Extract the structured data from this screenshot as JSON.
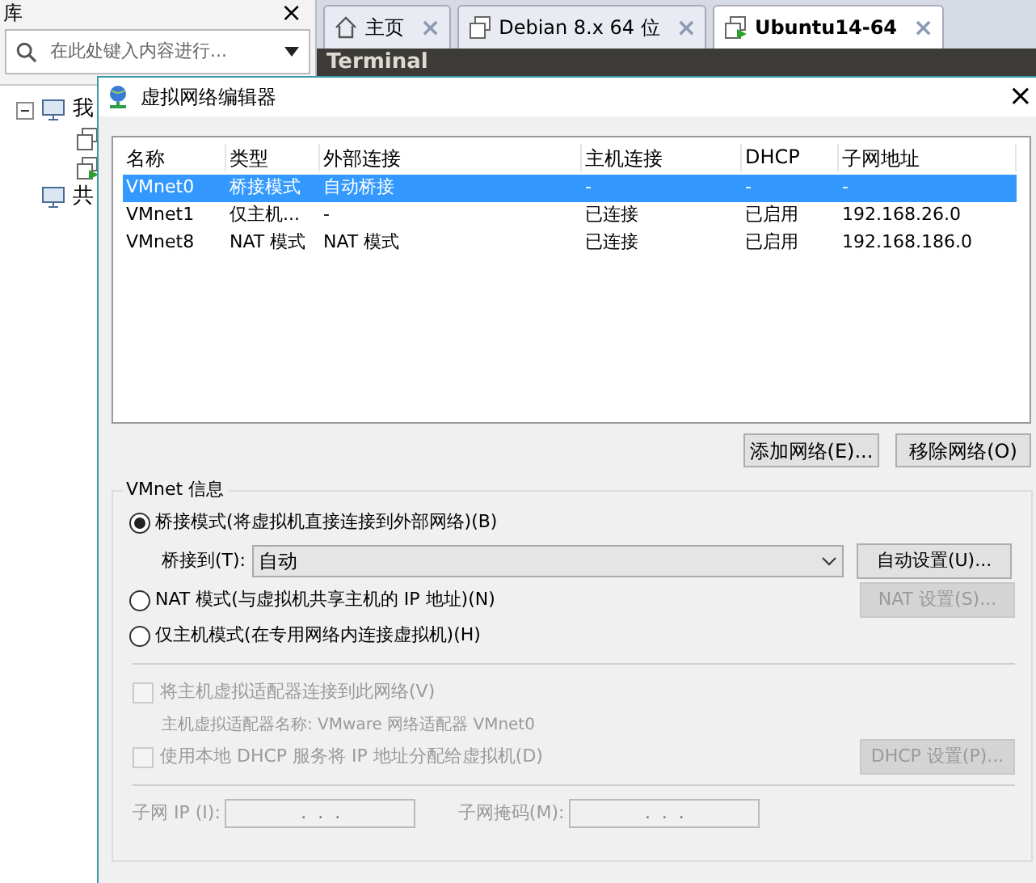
{
  "library": {
    "title": "库",
    "close": "×",
    "search": {
      "placeholder": "在此处键入内容进行..."
    },
    "tree": [
      {
        "label": "我",
        "expanded": true,
        "children": [
          {
            "kind": "vm"
          },
          {
            "kind": "vm-running"
          }
        ]
      },
      {
        "label": "共"
      }
    ]
  },
  "tabs": [
    {
      "label": "主页",
      "kind": "home",
      "selected": false,
      "close": "×"
    },
    {
      "label": "Debian 8.x 64 位",
      "kind": "vm",
      "selected": false,
      "close": "×"
    },
    {
      "label": "Ubuntu14-64",
      "kind": "vm-running",
      "selected": true,
      "close": "×"
    }
  ],
  "vm_title": "Terminal",
  "dialog": {
    "title": "虚拟网络编辑器",
    "close": "×",
    "table": {
      "columns": [
        "名称",
        "类型",
        "外部连接",
        "主机连接",
        "DHCP",
        "子网地址"
      ],
      "rows": [
        {
          "cells": [
            "VMnet0",
            "桥接模式",
            "自动桥接",
            "-",
            "-",
            "-"
          ],
          "selected": true
        },
        {
          "cells": [
            "VMnet1",
            "仅主机...",
            "-",
            "已连接",
            "已启用",
            "192.168.26.0"
          ],
          "selected": false
        },
        {
          "cells": [
            "VMnet8",
            "NAT 模式",
            "NAT 模式",
            "已连接",
            "已启用",
            "192.168.186.0"
          ],
          "selected": false
        }
      ]
    },
    "buttons": [
      "添加网络(E)...",
      "移除网络(O)"
    ],
    "info": {
      "title": "VMnet 信息",
      "modes": [
        {
          "label": "桥接模式(将虚拟机直接连接到外部网络)(B)",
          "selected": true
        },
        {
          "label": "NAT 模式(与虚拟机共享主机的 IP 地址)(N)",
          "selected": false
        },
        {
          "label": "仅主机模式(在专用网络内连接虚拟机)(H)",
          "selected": false
        }
      ],
      "bridge_label": "桥接到(T):",
      "bridge_value": "自动",
      "auto_button": {
        "label": "自动设置(U)...",
        "disabled": false
      },
      "nat_button": {
        "label": "NAT 设置(S)...",
        "disabled": true
      },
      "host_adapter": {
        "label": "将主机虚拟适配器连接到此网络(V)",
        "checked": false,
        "disabled": true
      },
      "adapter_name": "主机虚拟适配器名称: VMware 网络适配器 VMnet0",
      "dhcp": {
        "label": "使用本地 DHCP 服务将 IP 地址分配给虚拟机(D)",
        "checked": false,
        "disabled": true
      },
      "dhcp_button": {
        "label": "DHCP 设置(P)...",
        "disabled": true
      },
      "subnet_ip": {
        "label": "子网 IP (I):",
        "value": ".  .  ."
      },
      "subnet_mask": {
        "label": "子网掩码(M):",
        "value": ".  .  ."
      }
    }
  }
}
